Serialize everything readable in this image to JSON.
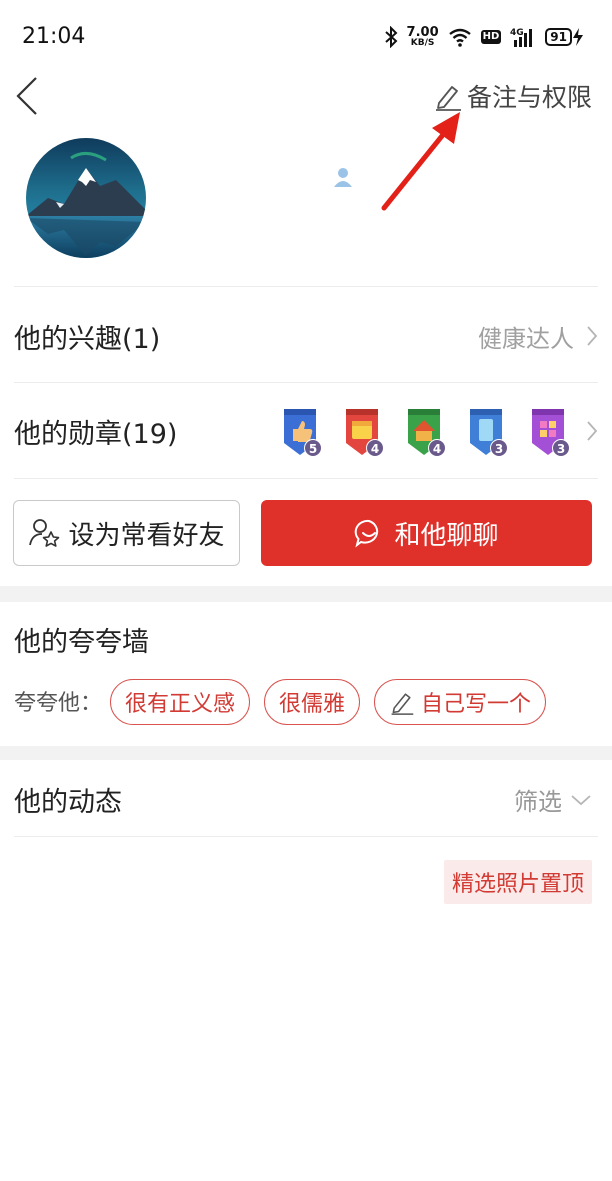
{
  "status_bar": {
    "time": "21:04",
    "net_speed_value": "7.00",
    "net_speed_unit": "KB/S",
    "network_badge": "HD",
    "signal_type": "4G",
    "battery_level": "91",
    "icons": [
      "bluetooth-icon",
      "wifi-icon",
      "signal-icon",
      "battery-icon",
      "charging-icon"
    ]
  },
  "header": {
    "back_icon": "chevron-left-icon",
    "remark_label": "备注与权限",
    "remark_icon": "pencil-icon"
  },
  "interests": {
    "title": "他的兴趣(1)",
    "value": "健康达人"
  },
  "medals": {
    "title": "他的勋章(19)",
    "items": [
      {
        "icon": "thumbs-up-medal-icon",
        "count": "5",
        "color": "#3b6fd6"
      },
      {
        "icon": "calendar-medal-icon",
        "count": "4",
        "color": "#e2463e"
      },
      {
        "icon": "house-medal-icon",
        "count": "4",
        "color": "#3aa34a"
      },
      {
        "icon": "phone-medal-icon",
        "count": "3",
        "color": "#3f7fd8"
      },
      {
        "icon": "grid-medal-icon",
        "count": "3",
        "color": "#a34fd6"
      }
    ]
  },
  "actions": {
    "favorite_label": "设为常看好友",
    "chat_label": "和他聊聊",
    "accent_color": "#e0302a"
  },
  "praise_wall": {
    "title": "他的夸夸墙",
    "label": "夸夸他：",
    "tags": [
      "很有正义感",
      "很儒雅"
    ],
    "write_own": "自己写一个"
  },
  "dynamics": {
    "title": "他的动态",
    "filter_label": "筛选",
    "pin_photos_label": "精选照片置顶"
  }
}
